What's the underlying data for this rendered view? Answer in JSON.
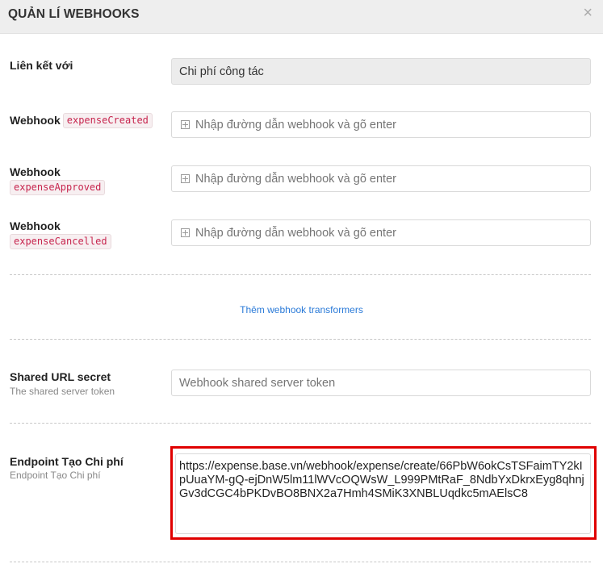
{
  "header": {
    "title": "QUẢN LÍ WEBHOOKS",
    "close_symbol": "×"
  },
  "linked_with": {
    "label": "Liên kết với",
    "value": "Chi phí công tác"
  },
  "webhooks": [
    {
      "label": "Webhook",
      "event": "expenseCreated",
      "placeholder": "Nhập đường dẫn webhook và gõ enter"
    },
    {
      "label": "Webhook",
      "event": "expenseApproved",
      "placeholder": "Nhập đường dẫn webhook và gõ enter"
    },
    {
      "label": "Webhook",
      "event": "expenseCancelled",
      "placeholder": "Nhập đường dẫn webhook và gõ enter"
    }
  ],
  "add_transformers_link": "Thêm webhook transformers",
  "shared_secret": {
    "label": "Shared URL secret",
    "hint": "The shared server token",
    "placeholder": "Webhook shared server token"
  },
  "endpoint": {
    "label": "Endpoint Tạo Chi phí",
    "hint": "Endpoint Tạo Chi phí",
    "value": "https://expense.base.vn/webhook/expense/create/66PbW6okCsTSFaimTY2kIpUuaYM-gQ-ejDnW5lm11lWVcOQWsW_L999PMtRaF_8NdbYxDkrxEyg8qhnjGv3dCGC4bPKDvBO8BNX2a7Hmh4SMiK3XNBLUqdkc5mAElsC8"
  },
  "colors": {
    "header_bg": "#eeeeee",
    "code_text": "#c7254e",
    "link": "#2a7ad8",
    "highlight_border": "#e00000"
  }
}
